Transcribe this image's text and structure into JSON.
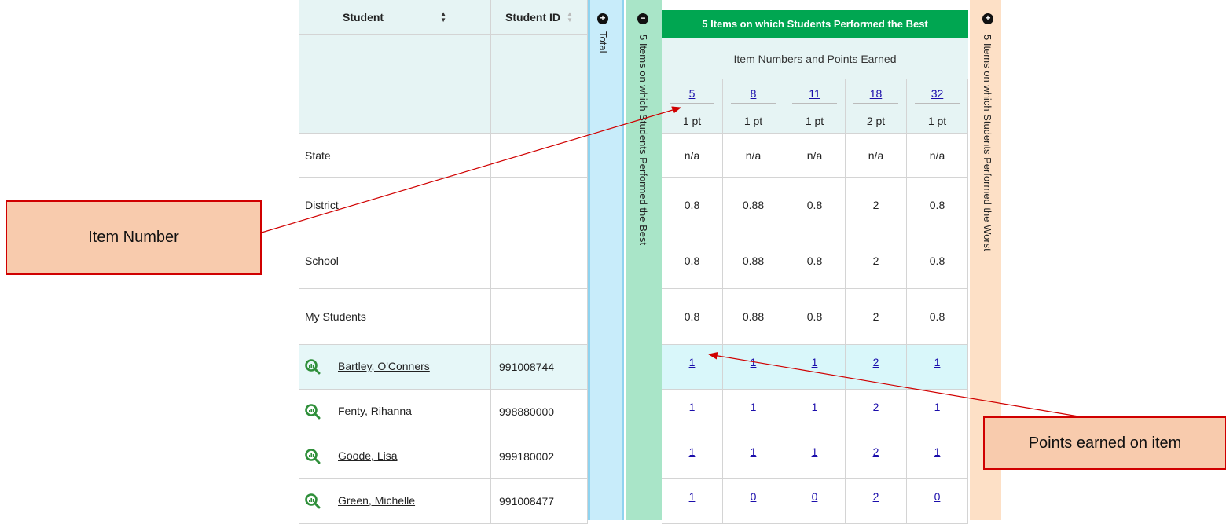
{
  "table": {
    "header": {
      "student_label": "Student",
      "student_id_label": "Student ID",
      "total_label": "Total",
      "best_collapsed_label": "5 Items on which Students Performed the Best",
      "best_title": "5 Items on which Students Performed the Best",
      "best_subtitle": "Item Numbers and Points Earned",
      "worst_collapsed_label": "5 Items on which Students Performed the Worst"
    },
    "items": [
      {
        "number": "5",
        "points": "1 pt"
      },
      {
        "number": "8",
        "points": "1 pt"
      },
      {
        "number": "11",
        "points": "1 pt"
      },
      {
        "number": "18",
        "points": "2 pt"
      },
      {
        "number": "32",
        "points": "1 pt"
      }
    ],
    "aggregate_rows": [
      {
        "label": "State",
        "values": [
          "n/a",
          "n/a",
          "n/a",
          "n/a",
          "n/a"
        ]
      },
      {
        "label": "District",
        "values": [
          "0.8",
          "0.88",
          "0.8",
          "2",
          "0.8"
        ]
      },
      {
        "label": "School",
        "values": [
          "0.8",
          "0.88",
          "0.8",
          "2",
          "0.8"
        ]
      },
      {
        "label": "My Students",
        "values": [
          "0.8",
          "0.88",
          "0.8",
          "2",
          "0.8"
        ]
      }
    ],
    "student_rows": [
      {
        "name": "Bartley, O'Conners",
        "id": "991008744",
        "scores": [
          "1",
          "1",
          "1",
          "2",
          "1"
        ]
      },
      {
        "name": "Fenty, Rihanna",
        "id": "998880000",
        "scores": [
          "1",
          "1",
          "1",
          "2",
          "1"
        ]
      },
      {
        "name": "Goode, Lisa",
        "id": "999180002",
        "scores": [
          "1",
          "1",
          "1",
          "2",
          "1"
        ]
      },
      {
        "name": "Green, Michelle",
        "id": "991008477",
        "scores": [
          "1",
          "0",
          "0",
          "2",
          "0"
        ]
      }
    ]
  },
  "callouts": {
    "item_number": "Item Number",
    "points_earned": "Points earned on item"
  },
  "colors": {
    "header_bg": "#e6f4f4",
    "best_header": "#00a651",
    "best_strip": "#a9e5c8",
    "total_strip": "#c8ecfa",
    "worst_strip": "#fde0c6",
    "highlight_row": "#d9f7fa",
    "callout_fill": "#f8cbad",
    "callout_border": "#d00000",
    "link": "#1a0dab"
  },
  "icons": {
    "expand": "plus-circle-icon",
    "collapse": "minus-circle-icon",
    "student_report": "magnifier-chart-icon",
    "sort": "sort-arrows-icon"
  }
}
